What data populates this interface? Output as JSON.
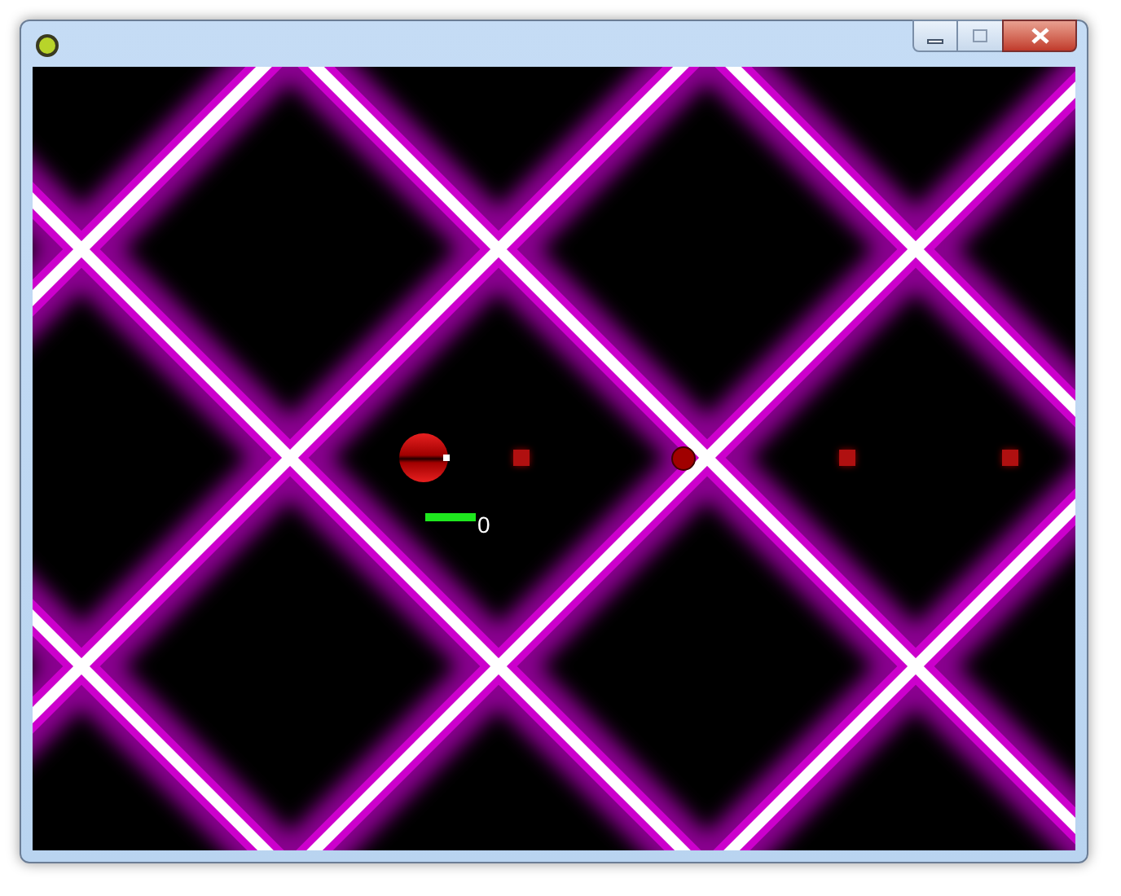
{
  "hud": {
    "score": "0"
  }
}
